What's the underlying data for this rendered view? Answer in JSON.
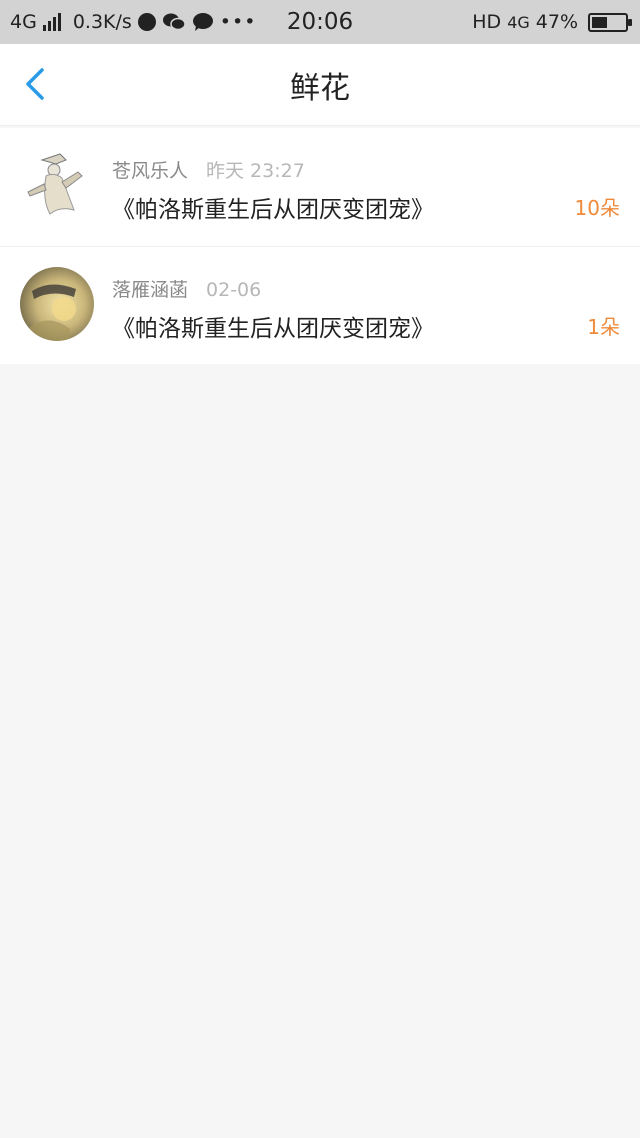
{
  "status_bar": {
    "network": "4G",
    "speed": "0.3K/s",
    "time": "20:06",
    "hd": "HD",
    "network_right": "4G",
    "battery": "47%",
    "battery_level": 0.47
  },
  "header": {
    "title": "鲜花"
  },
  "flowers": [
    {
      "user": "苍风乐人",
      "time": "昨天 23:27",
      "book": "《帕洛斯重生后从团厌变团宠》",
      "count": "10朵"
    },
    {
      "user": "落雁涵菡",
      "time": "02-06",
      "book": "《帕洛斯重生后从团厌变团宠》",
      "count": "1朵"
    }
  ],
  "colors": {
    "accent": "#2a9be6",
    "count": "#ef8a3a"
  }
}
